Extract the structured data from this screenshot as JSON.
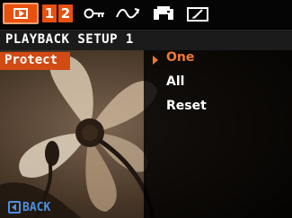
{
  "tabs": {
    "playback_icon": "playback-icon",
    "num1": "1",
    "num2": "2",
    "icon3": "key-icon",
    "icon4": "wave-icon",
    "icon5": "print-icon",
    "icon6": "edit-icon"
  },
  "title": "PLAYBACK SETUP 1",
  "menu": {
    "selected_item": "Protect",
    "options": [
      "One",
      "All",
      "Reset"
    ],
    "selected_option_index": 0
  },
  "back_label": "BACK",
  "colors": {
    "accent": "#e8500f",
    "highlight_text": "#f07a30",
    "back": "#4c8fe0"
  }
}
